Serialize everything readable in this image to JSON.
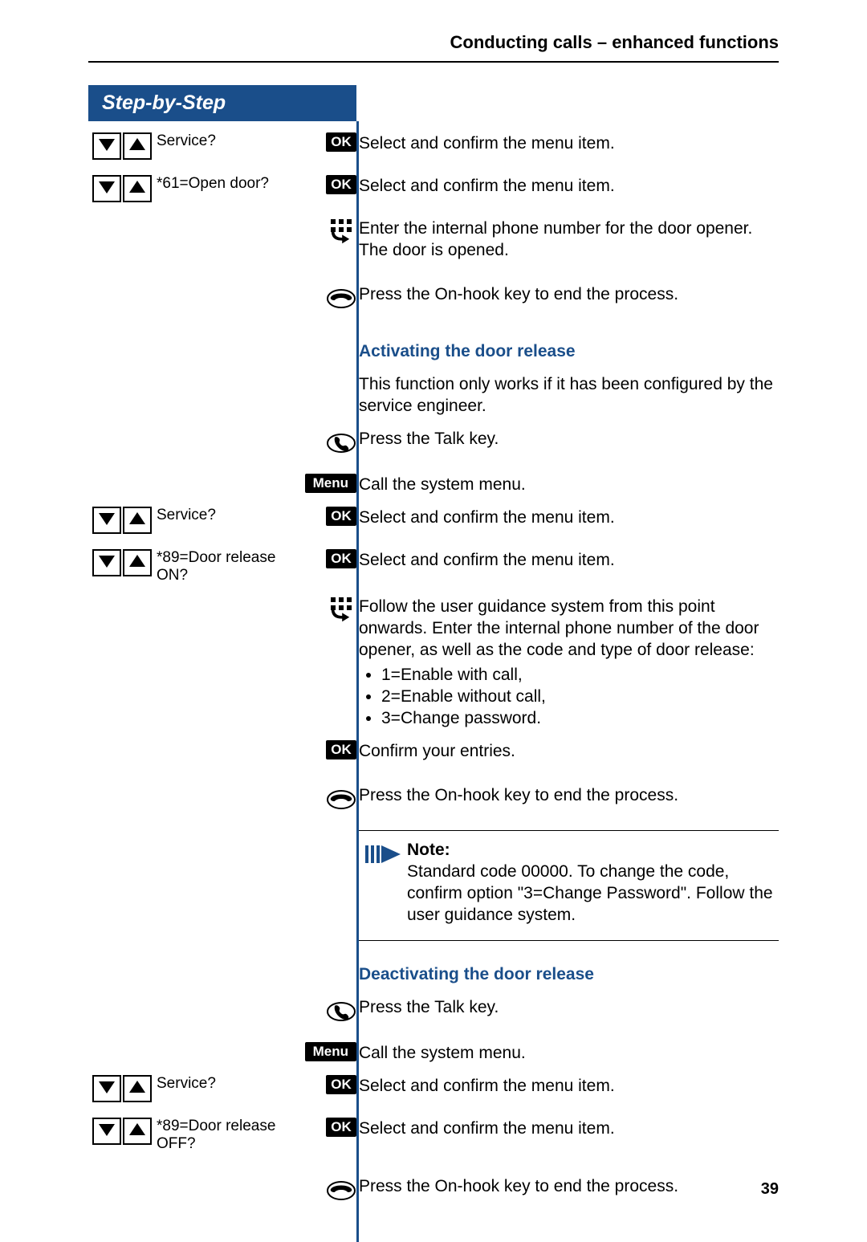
{
  "header": {
    "running": "Conducting calls – enhanced functions"
  },
  "step_header": "Step-by-Step",
  "badges": {
    "ok": "OK",
    "menu": "Menu"
  },
  "notebox": {
    "label": "Note:",
    "text": "Standard code 00000. To change the code, confirm option \"3=Change Password\". Follow the user guidance system."
  },
  "sections": {
    "activate_title": "Activating the door release",
    "deactivate_title": "Deactivating the door release"
  },
  "rows": {
    "r1_menu": "Service?",
    "r1_instr": "Select and confirm the menu item.",
    "r2_menu": "*61=Open door?",
    "r2_instr": "Select and confirm the menu item.",
    "r3_instr": "Enter the internal phone number for the door opener. The door is opened.",
    "r4_instr": "Press the On-hook key to end the process.",
    "r5_instr": "This function only works if it has been configured by the service engineer.",
    "r6_instr": "Press the Talk key.",
    "r7_instr": "Call the system menu.",
    "r8_menu": "Service?",
    "r8_instr": "Select and confirm the menu item.",
    "r9_menu": "*89=Door release ON?",
    "r9_instr": "Select and confirm the menu item.",
    "r10_instr": "Follow the user guidance system from this point onwards. Enter the internal phone number of the door opener, as well as the code and type of door release:",
    "r10_opts": [
      "1=Enable with call,",
      "2=Enable without call,",
      "3=Change password."
    ],
    "r11_instr": "Confirm your entries.",
    "r12_instr": "Press the On-hook key to end the process.",
    "r13_instr": "Press the Talk key.",
    "r14_instr": "Call the system menu.",
    "r15_menu": "Service?",
    "r15_instr": "Select and confirm the menu item.",
    "r16_menu": "*89=Door release OFF?",
    "r16_instr": "Select and confirm the menu item.",
    "r17_instr": "Press the On-hook key to end the process."
  },
  "page_number": "39"
}
